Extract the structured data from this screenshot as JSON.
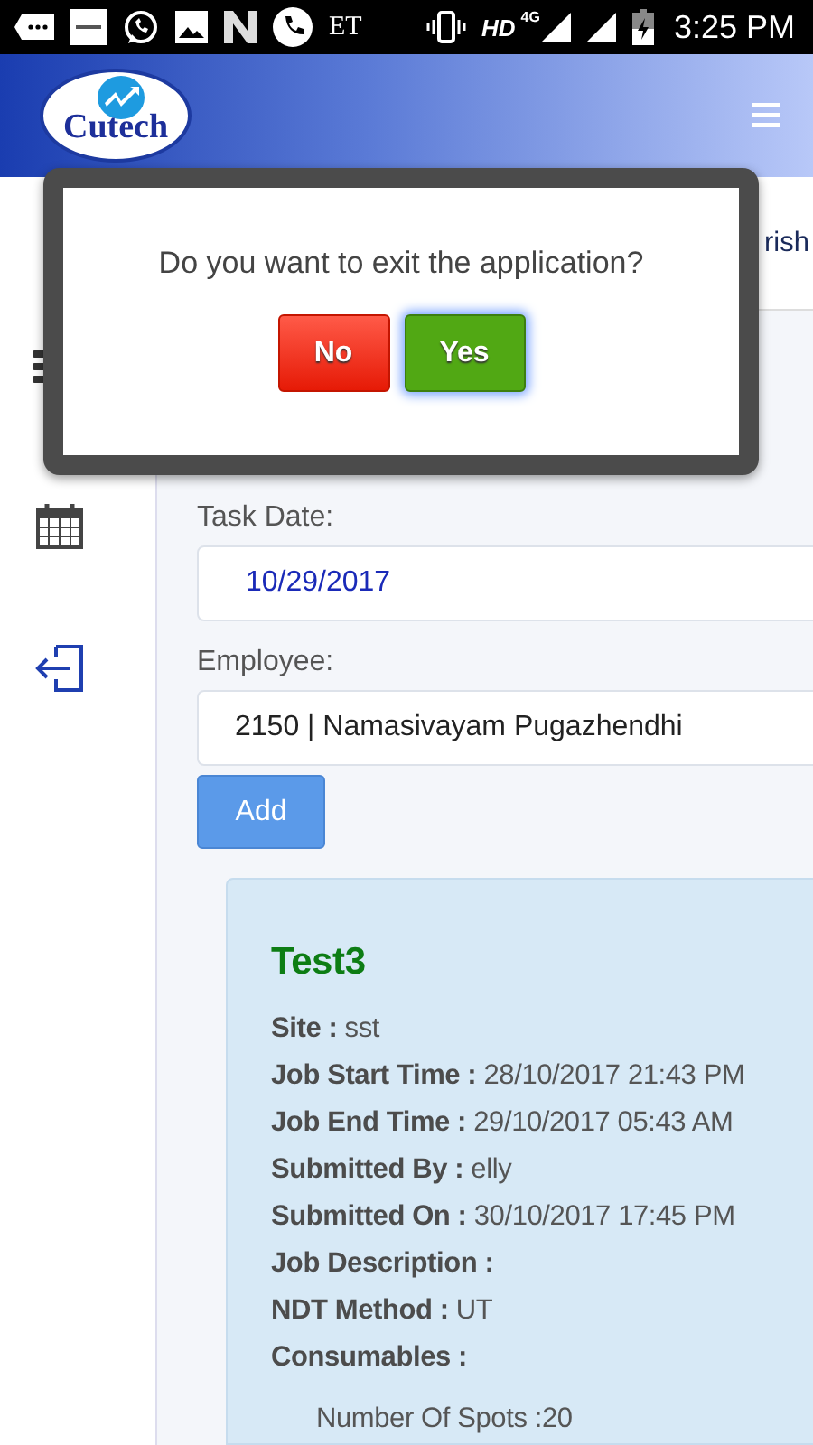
{
  "status_bar": {
    "left_text": "ET",
    "network": "HD",
    "network_type": "4G",
    "time": "3:25 PM"
  },
  "header": {
    "logo_text": "Cutech"
  },
  "sub_header": {
    "text": "rish"
  },
  "form": {
    "task_date_label": "Task Date:",
    "task_date_value": "10/29/2017",
    "employee_label": "Employee:",
    "employee_value": "2150 | Namasivayam Pugazhendhi",
    "add_button": "Add"
  },
  "job_card": {
    "title": "Test3",
    "fields": [
      {
        "label": "Site :",
        "value": "sst"
      },
      {
        "label": "Job Start Time :",
        "value": "28/10/2017 21:43 PM"
      },
      {
        "label": "Job End Time :",
        "value": "29/10/2017 05:43 AM"
      },
      {
        "label": "Submitted By :",
        "value": "elly"
      },
      {
        "label": "Submitted On :",
        "value": "30/10/2017 17:45 PM"
      },
      {
        "label": "Job Description :"
      },
      {
        "label": "NDT Method :",
        "value": "UT"
      },
      {
        "label": "Consumables :"
      }
    ],
    "consumables": [
      "Number Of Spots :20"
    ]
  },
  "dialog": {
    "message": "Do you want to exit the application?",
    "buttons": [
      {
        "label": "No",
        "kind": "cancel",
        "focused": false
      },
      {
        "label": "Yes",
        "kind": "confirm",
        "focused": true
      }
    ]
  }
}
